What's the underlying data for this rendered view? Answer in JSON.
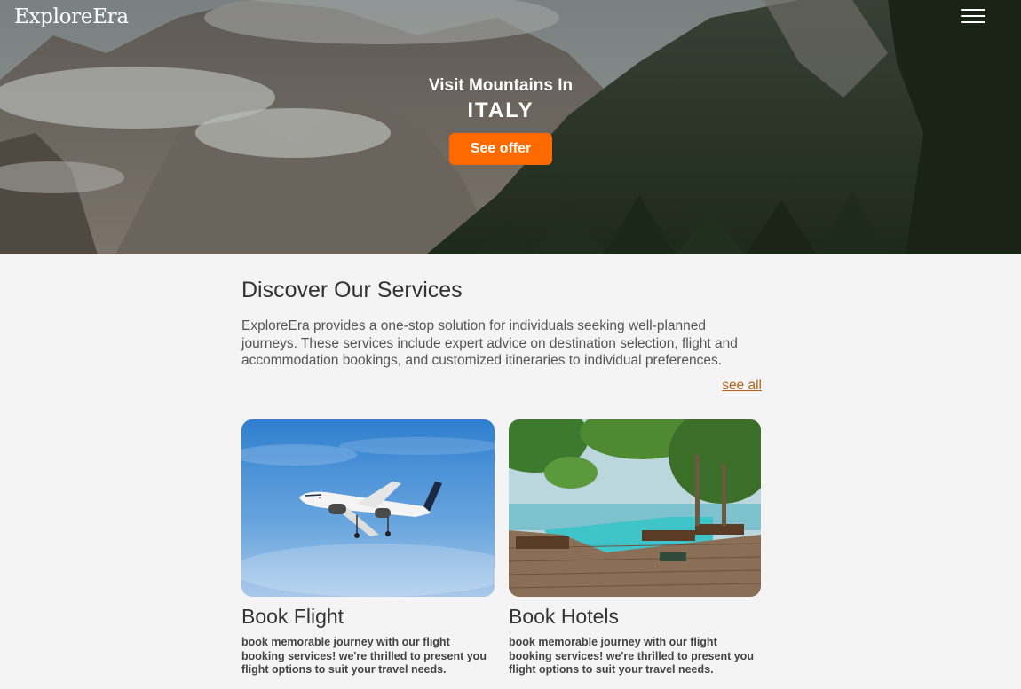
{
  "header": {
    "logo": "ExploreEra",
    "menu_icon": "hamburger-menu-icon"
  },
  "hero": {
    "subtitle": "Visit Mountains In",
    "title": "ITALY",
    "button_label": "See offer",
    "accent": "#ff6a00"
  },
  "services": {
    "heading": "Discover Our Services",
    "description": "ExploreEra provides a one-stop solution for individuals seeking well-planned journeys. These services include expert advice on destination selection, flight and accommodation bookings, and customized itineraries to individual preferences.",
    "see_all": "see all",
    "cards": [
      {
        "title": "Book Flight",
        "text": "book memorable journey with our flight booking services! we're thrilled to present you flight options to suit your travel needs.",
        "image": "airplane-photo"
      },
      {
        "title": "Book Hotels",
        "text": "book memorable journey with our flight booking services! we're thrilled to present you flight options to suit your travel needs.",
        "image": "resort-pool-photo"
      }
    ]
  }
}
